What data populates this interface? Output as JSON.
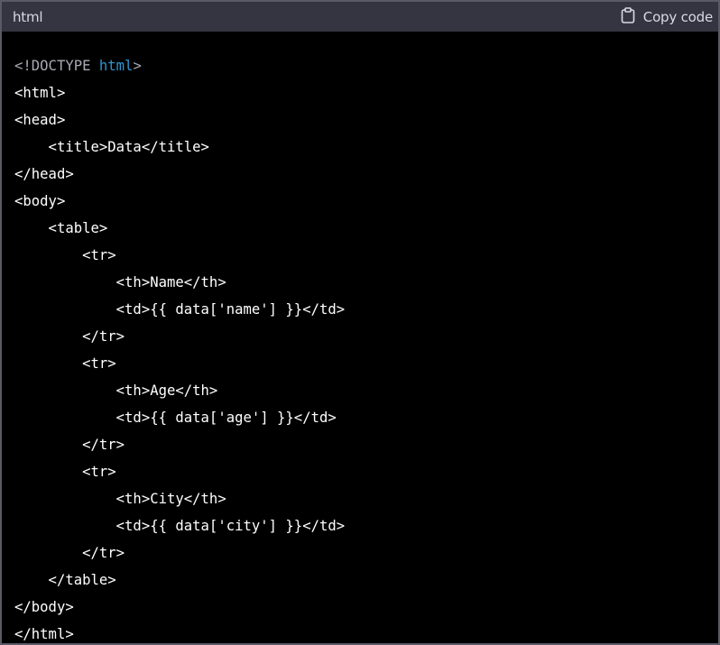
{
  "header": {
    "language": "html",
    "copy_label": "Copy code"
  },
  "colors": {
    "header_bg": "#343541",
    "code_bg": "#000000",
    "text": "#ffffff",
    "doctype": "#a9a9b3",
    "keyword": "#2e95d3"
  },
  "code": {
    "doctype_open": "<!DOCTYPE",
    "doctype_keyword": "html",
    "doctype_close": ">",
    "lines": [
      "<html>",
      "<head>",
      "    <title>Data</title>",
      "</head>",
      "<body>",
      "    <table>",
      "        <tr>",
      "            <th>Name</th>",
      "            <td>{{ data['name'] }}</td>",
      "        </tr>",
      "        <tr>",
      "            <th>Age</th>",
      "            <td>{{ data['age'] }}</td>",
      "        </tr>",
      "        <tr>",
      "            <th>City</th>",
      "            <td>{{ data['city'] }}</td>",
      "        </tr>",
      "    </table>",
      "</body>",
      "</html>"
    ]
  }
}
